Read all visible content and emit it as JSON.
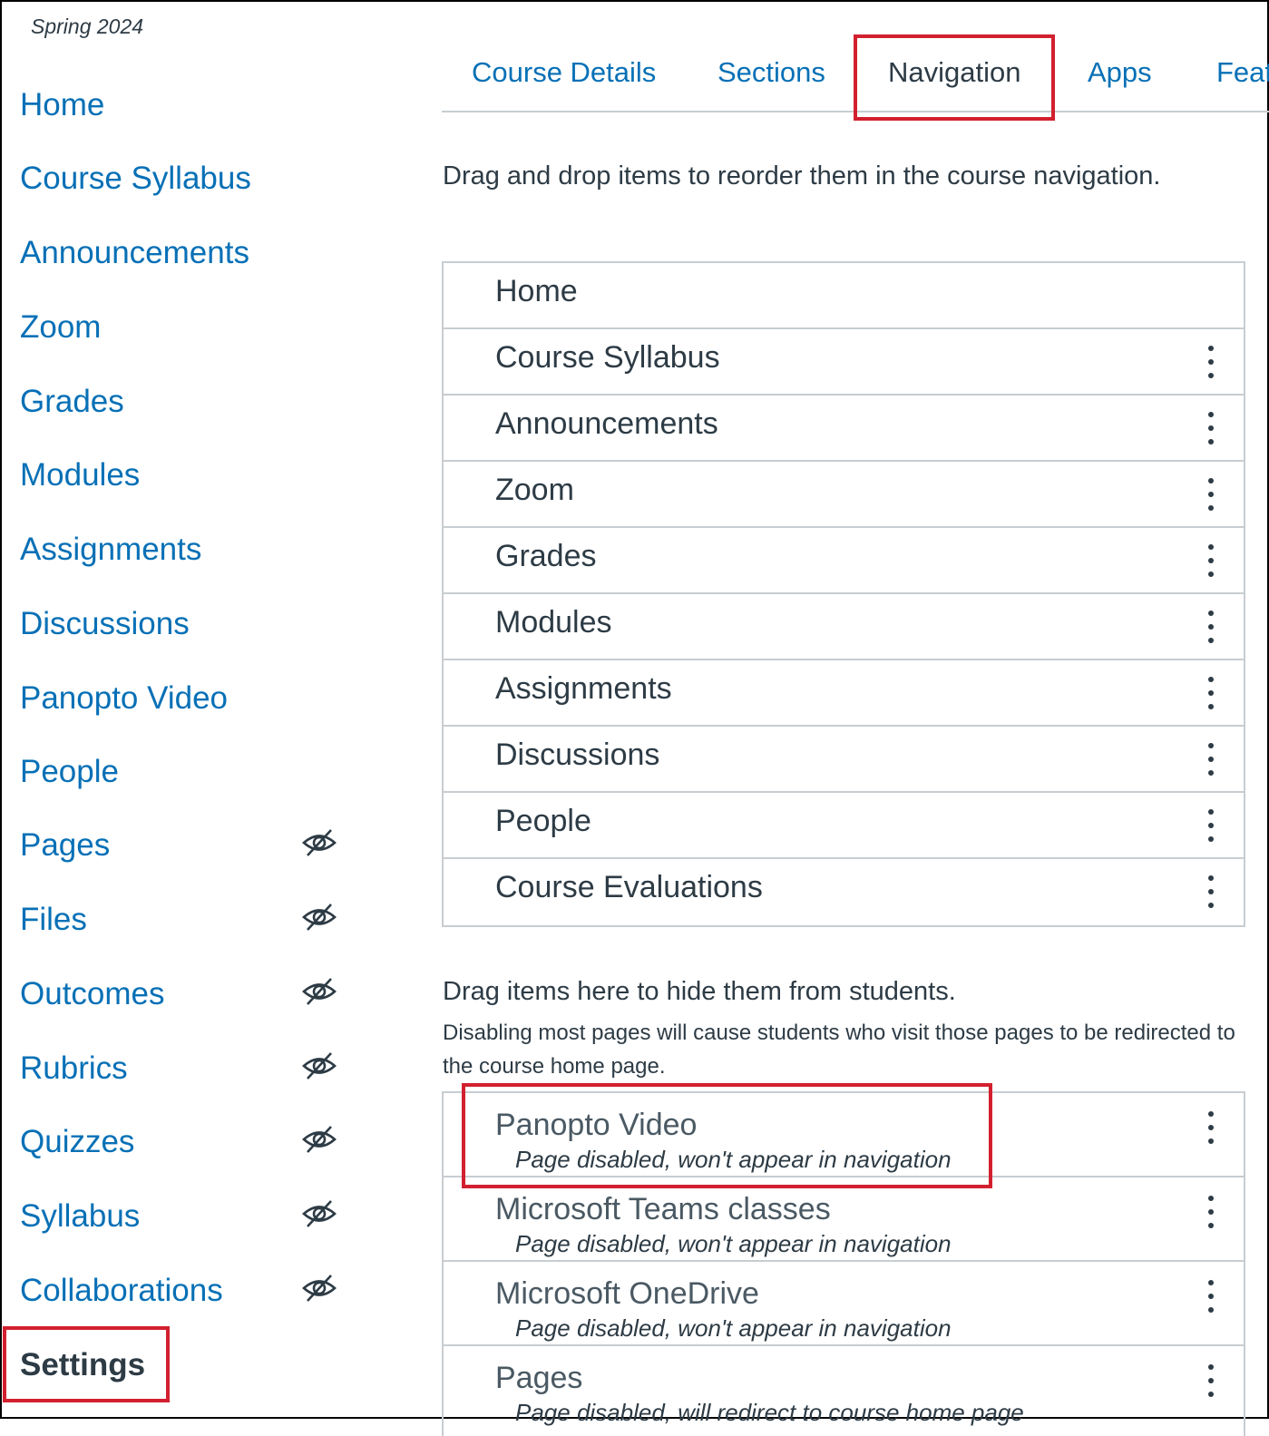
{
  "course": {
    "term": "Spring 2024"
  },
  "sidebar": {
    "items": [
      {
        "label": "Home",
        "hidden": false
      },
      {
        "label": "Course Syllabus",
        "hidden": false
      },
      {
        "label": "Announcements",
        "hidden": false
      },
      {
        "label": "Zoom",
        "hidden": false
      },
      {
        "label": "Grades",
        "hidden": false
      },
      {
        "label": "Modules",
        "hidden": false
      },
      {
        "label": "Assignments",
        "hidden": false
      },
      {
        "label": "Discussions",
        "hidden": false
      },
      {
        "label": "Panopto Video",
        "hidden": false
      },
      {
        "label": "People",
        "hidden": false
      },
      {
        "label": "Pages",
        "hidden": true
      },
      {
        "label": "Files",
        "hidden": true
      },
      {
        "label": "Outcomes",
        "hidden": true
      },
      {
        "label": "Rubrics",
        "hidden": true
      },
      {
        "label": "Quizzes",
        "hidden": true
      },
      {
        "label": "Syllabus",
        "hidden": true
      },
      {
        "label": "Collaborations",
        "hidden": true
      },
      {
        "label": "Settings",
        "active": true
      }
    ],
    "hidden_icon": "eye-slash-icon"
  },
  "tabs": [
    {
      "label": "Course Details"
    },
    {
      "label": "Sections"
    },
    {
      "label": "Navigation",
      "active": true
    },
    {
      "label": "Apps"
    },
    {
      "label": "Feat"
    }
  ],
  "instructions": "Drag and drop items to reorder them in the course navigation.",
  "enabled_items": [
    {
      "label": "Home",
      "menu": false
    },
    {
      "label": "Course Syllabus",
      "menu": true
    },
    {
      "label": "Announcements",
      "menu": true
    },
    {
      "label": "Zoom",
      "menu": true
    },
    {
      "label": "Grades",
      "menu": true
    },
    {
      "label": "Modules",
      "menu": true
    },
    {
      "label": "Assignments",
      "menu": true
    },
    {
      "label": "Discussions",
      "menu": true
    },
    {
      "label": "People",
      "menu": true
    },
    {
      "label": "Course Evaluations",
      "menu": true
    }
  ],
  "hidden_section": {
    "title": "Drag items here to hide them from students.",
    "subtitle": "Disabling most pages will cause students who visit those pages to be redirected to the course home page."
  },
  "disabled_items": [
    {
      "label": "Panopto Video",
      "status": "Page disabled, won't appear in navigation"
    },
    {
      "label": "Microsoft Teams classes",
      "status": "Page disabled, won't appear in navigation"
    },
    {
      "label": "Microsoft OneDrive",
      "status": "Page disabled, won't appear in navigation"
    },
    {
      "label": "Pages",
      "status": "Page disabled, will redirect to course home page"
    }
  ],
  "colors": {
    "link": "#0770b6",
    "text": "#2d3b45",
    "highlight": "#d2202f",
    "border": "#c7cdd1"
  }
}
